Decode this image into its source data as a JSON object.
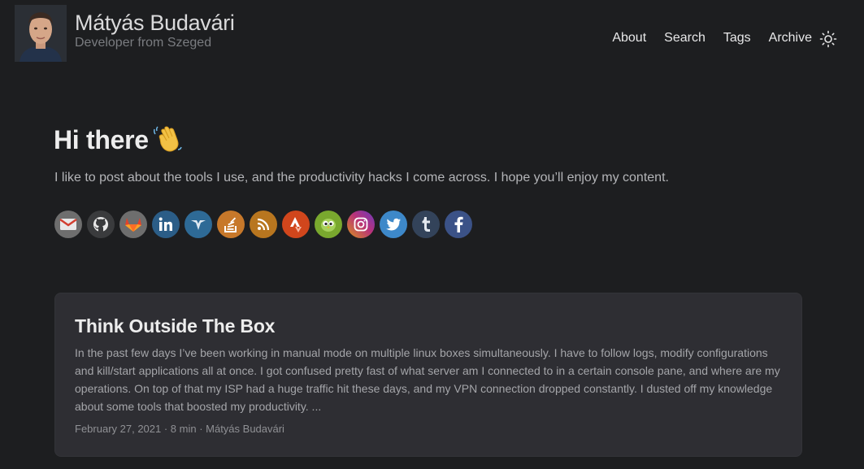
{
  "header": {
    "site_title": "Mátyás Budavári",
    "site_subtitle": "Developer from Szeged",
    "nav": [
      "About",
      "Search",
      "Tags",
      "Archive"
    ],
    "theme_toggle_icon": "sun-icon"
  },
  "hero": {
    "title": "Hi there",
    "emoji": "waving-hand-icon",
    "text": "I like to post about the tools I use, and the productivity hacks I come across. I hope you’ll enjoy my content."
  },
  "socials": [
    {
      "name": "gmail",
      "color": "#6e6e6e"
    },
    {
      "name": "github",
      "color": "#3a3b3d"
    },
    {
      "name": "gitlab",
      "color": "#6e6e6e"
    },
    {
      "name": "linkedin",
      "color": "#2b5d87"
    },
    {
      "name": "goodreads",
      "color": "#2e6a96"
    },
    {
      "name": "stackoverflow",
      "color": "#c7782a"
    },
    {
      "name": "rss",
      "color": "#b8761f"
    },
    {
      "name": "strava",
      "color": "#d1461c"
    },
    {
      "name": "duolingo",
      "color": "#79a82e"
    },
    {
      "name": "instagram",
      "color": "#b83a8a"
    },
    {
      "name": "twitter",
      "color": "#3d88c9"
    },
    {
      "name": "tumblr",
      "color": "#33435a"
    },
    {
      "name": "facebook",
      "color": "#3b5287"
    }
  ],
  "post": {
    "title": "Think Outside The Box",
    "summary": "In the past few days I’ve been working in manual mode on multiple linux boxes simultaneously. I have to follow logs, modify configurations and kill/start applications all at once. I got confused pretty fast of what server am I connected to in a certain console pane, and where are my operations. On top of that my ISP had a huge traffic hit these days, and my VPN connection dropped constantly. I dusted off my knowledge about some tools that boosted my productivity. ...",
    "meta": "February 27, 2021 · 8 min · Mátyás Budavári"
  }
}
